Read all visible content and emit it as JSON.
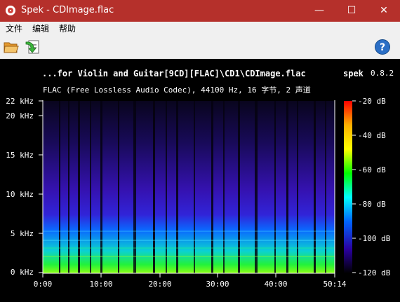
{
  "window": {
    "title": "Spek - CDImage.flac",
    "minimize_label": "—",
    "maximize_label": "☐",
    "close_label": "✕"
  },
  "menu": {
    "items": [
      "文件",
      "编辑",
      "帮助"
    ]
  },
  "toolbar": {
    "open_icon": "folder-open-icon",
    "save_icon": "save-image-icon",
    "help_icon": "help-icon",
    "help_label": "?"
  },
  "spectrogram": {
    "file_title": "...for Violin and Guitar[9CD][FLAC]\\CD1\\CDImage.flac",
    "app_name": "spek",
    "app_version": "0.8.2",
    "file_info": "FLAC (Free Lossless Audio Codec), 44100 Hz, 16 字节, 2 声道",
    "frequency_labels": [
      "22 kHz",
      "20 kHz",
      "15 kHz",
      "10 kHz",
      "5 kHz",
      "0 kHz"
    ],
    "time_labels": [
      "0:00",
      "10:00",
      "20:00",
      "30:00",
      "40:00",
      "50:14"
    ],
    "db_labels": [
      "-20 dB",
      "-40 dB",
      "-60 dB",
      "-80 dB",
      "-100 dB",
      "-120 dB"
    ],
    "colors": {
      "background": "#000000",
      "titlebar": "#b5302b",
      "palette_top": "#ff0000",
      "palette_mid": "#00ff00",
      "palette_low": "#0000ff",
      "palette_bottom": "#000000"
    }
  }
}
